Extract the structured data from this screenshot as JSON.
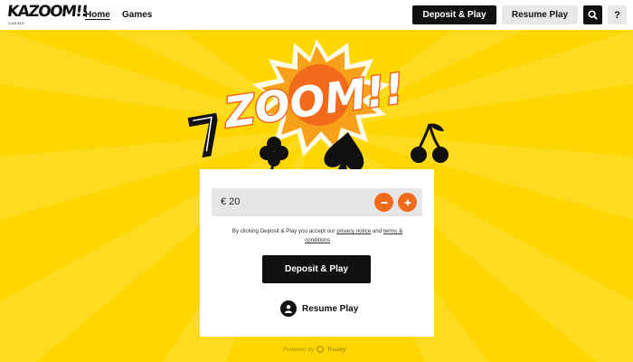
{
  "header": {
    "logo_text": "KAZOOM!!",
    "logo_sub": "CASINO",
    "nav": [
      {
        "label": "Home"
      },
      {
        "label": "Games"
      }
    ],
    "deposit_label": "Deposit & Play",
    "resume_label": "Resume Play",
    "search_icon": "search-icon",
    "help_label": "?"
  },
  "hero": {
    "zoom_text": "ZOOM!!",
    "symbols": [
      "seven-icon",
      "clover-icon",
      "spade-icon",
      "cherries-icon"
    ]
  },
  "card": {
    "amount": "€ 20",
    "terms_prefix": "By clicking Deposit & Play you accept our ",
    "privacy_link": "privacy notice",
    "terms_and": " and ",
    "terms_link": "terms & conditions",
    "deposit_label": "Deposit & Play",
    "resume_label": "Resume Play"
  },
  "footer": {
    "powered_by": "Powered by",
    "brand": "Trustly"
  },
  "colors": {
    "background": "#ffd700",
    "accent": "#f26b1d",
    "primary_button": "#111111"
  }
}
